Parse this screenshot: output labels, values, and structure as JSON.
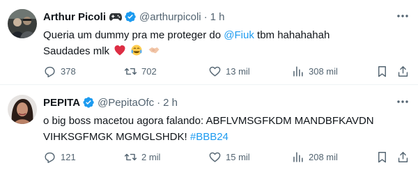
{
  "tweets": [
    {
      "name": "Arthur Picoli",
      "name_badge_icon": "game-controller-icon",
      "handle": "@arthurpicoli",
      "time": "1 h",
      "text": {
        "line1_before": "Queria um dummy pra me proteger do ",
        "line1_mention": "@Fiuk",
        "line1_after": " tbm hahahahah",
        "line2": "Saudades mlk",
        "line2_emojis": [
          "red-heart-emoji",
          "tears-of-joy-emoji",
          "handshake-emoji"
        ]
      },
      "actions": {
        "replies": "378",
        "reposts": "702",
        "likes": "13 mil",
        "views": "308 mil"
      }
    },
    {
      "name": "PEPITA",
      "handle": "@PepitaOfc",
      "time": "2 h",
      "text": {
        "line1": "o big boss macetou agora falando: ABFLVMSGFKDM MANDBFKAVDN",
        "line2_before": "VIHKSGFMGK MGMGLSHDK! ",
        "line2_hashtag": "#BBB24"
      },
      "actions": {
        "replies": "121",
        "reposts": "2 mil",
        "likes": "15 mil",
        "views": "208 mil"
      }
    }
  ],
  "colors": {
    "text": "#0f1419",
    "secondary": "#536471",
    "link": "#1d9bf0",
    "verified": "#1d9bf0",
    "divider": "#eff3f4"
  }
}
